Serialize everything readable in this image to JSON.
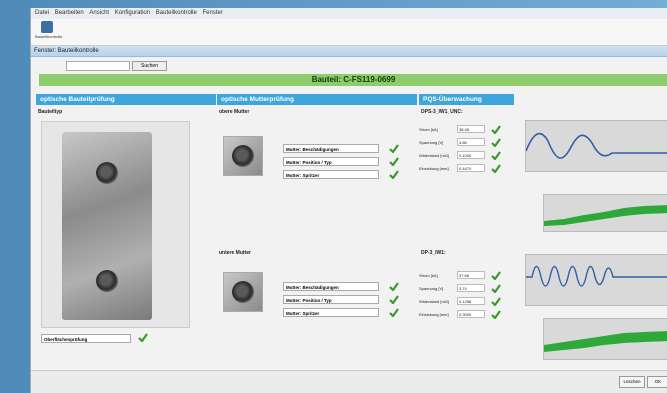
{
  "menu": [
    "Datei",
    "Bearbeiten",
    "Ansicht",
    "Konfiguration",
    "Bauteilkontrolle",
    "Fenster"
  ],
  "toolbar": {
    "button_label": "Bauteilkontrolle"
  },
  "window_title": "Fenster: Bauteilkontrolle",
  "search": {
    "button_label": "Suchen"
  },
  "bauteil_label": "Bauteil: C-FS119-0699",
  "panel1": {
    "title": "optische Bauteilprüfung",
    "sub": "Bauteiltyp",
    "status_label": "Oberflächenprüfung"
  },
  "panel2": {
    "title": "optische Mutterprüfung",
    "upper_label": "obere Mutter",
    "lower_label": "untere Mutter",
    "checks": [
      "Mutter: Beschädigungen",
      "Mutter: Position / Typ",
      "Mutter: Spritzer"
    ]
  },
  "panel3": {
    "title": "PQS-Überwachung",
    "sensor1": "DPS-3_IW1_UNC:",
    "sensor2": "DP-3_IW1:",
    "metric_names": [
      "Strom [kA]",
      "Spannung [V]",
      "Widerstand [mΩ]",
      "Einsinkung [mm]"
    ],
    "values1": [
      "38.48",
      "3.85",
      "0.1000",
      "0.4470"
    ],
    "values2": [
      "37.68",
      "3.74",
      "0.1258",
      "0.3000"
    ]
  },
  "footer": {
    "btn1": "Löschen",
    "btn2": "OK"
  },
  "colors": {
    "accent_blue": "#3fa6dc",
    "bauteil_green": "#8ecb6a",
    "check_green": "#3a9a2a",
    "trace_blue": "#2f5fa8",
    "band_green": "#2fa83a"
  }
}
